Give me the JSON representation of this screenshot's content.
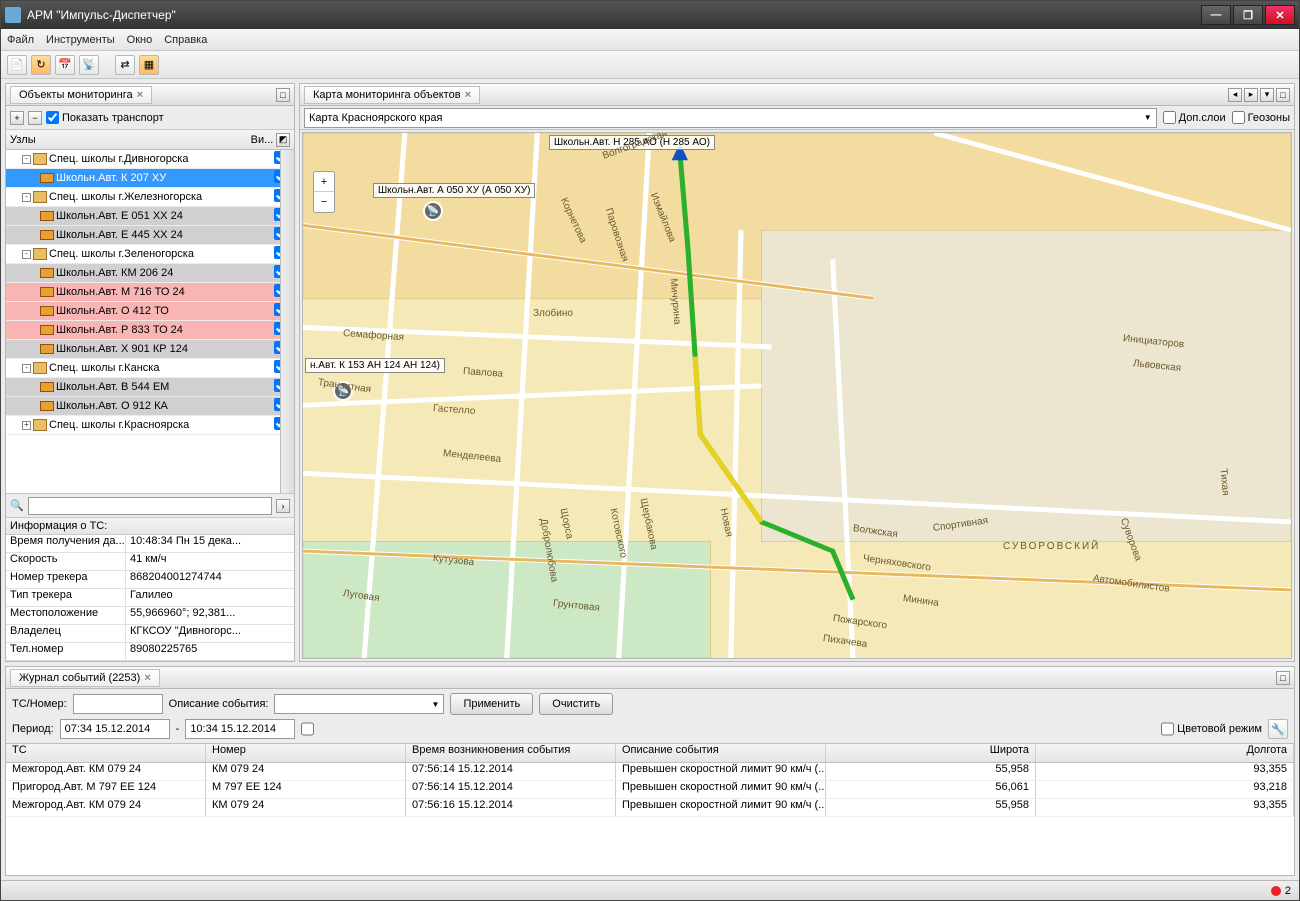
{
  "window": {
    "title": "АРМ \"Импульс-Диспетчер\""
  },
  "menu": {
    "file": "Файл",
    "tools": "Инструменты",
    "window": "Окно",
    "help": "Справка"
  },
  "left": {
    "tab": "Объекты мониторинга",
    "show_transport": "Показать транспорт",
    "col_nodes": "Узлы",
    "col_vis": "Ви...",
    "search_icon": "🔍",
    "info_header": "Информация о ТС:"
  },
  "tree": [
    {
      "lvl": 1,
      "exp": "-",
      "cls": "",
      "t": "Спец. школы г.Дивногорска",
      "chk": true
    },
    {
      "lvl": 2,
      "exp": "",
      "cls": "selected",
      "t": "Школьн.Авт. К 207 ХУ",
      "chk": true
    },
    {
      "lvl": 1,
      "exp": "-",
      "cls": "",
      "t": "Спец. школы г.Железногорска",
      "chk": true
    },
    {
      "lvl": 2,
      "exp": "",
      "cls": "gray",
      "t": "Школьн.Авт. Е 051 ХХ 24",
      "chk": true
    },
    {
      "lvl": 2,
      "exp": "",
      "cls": "gray",
      "t": "Школьн.Авт. Е 445 ХХ 24",
      "chk": true
    },
    {
      "lvl": 1,
      "exp": "-",
      "cls": "",
      "t": "Спец. школы г.Зеленогорска",
      "chk": true
    },
    {
      "lvl": 2,
      "exp": "",
      "cls": "gray",
      "t": "Школьн.Авт. КМ 206 24",
      "chk": true
    },
    {
      "lvl": 2,
      "exp": "",
      "cls": "pink",
      "t": "Школьн.Авт. М 716 ТО 24",
      "chk": true
    },
    {
      "lvl": 2,
      "exp": "",
      "cls": "pink",
      "t": "Школьн.Авт. О 412 ТО",
      "chk": true
    },
    {
      "lvl": 2,
      "exp": "",
      "cls": "pink",
      "t": "Школьн.Авт. Р 833 ТО 24",
      "chk": true
    },
    {
      "lvl": 2,
      "exp": "",
      "cls": "gray",
      "t": "Школьн.Авт. Х 901 КР 124",
      "chk": true
    },
    {
      "lvl": 1,
      "exp": "-",
      "cls": "",
      "t": "Спец. школы г.Канска",
      "chk": true
    },
    {
      "lvl": 2,
      "exp": "",
      "cls": "gray",
      "t": "Школьн.Авт. В 544 ЕМ",
      "chk": true
    },
    {
      "lvl": 2,
      "exp": "",
      "cls": "gray",
      "t": "Школьн.Авт. О 912 КА",
      "chk": true
    },
    {
      "lvl": 1,
      "exp": "+",
      "cls": "",
      "t": "Спец. школы г.Красноярска",
      "chk": true
    }
  ],
  "info": [
    {
      "l": "Время получения да...",
      "v": "10:48:34 Пн 15 дека..."
    },
    {
      "l": "Скорость",
      "v": "41 км/ч"
    },
    {
      "l": "Номер трекера",
      "v": "868204001274744"
    },
    {
      "l": "Тип трекера",
      "v": "Галилео"
    },
    {
      "l": "Местоположение",
      "v": "55,966960°; 92,381..."
    },
    {
      "l": "Владелец",
      "v": "КГКСОУ \"Дивногорс..."
    },
    {
      "l": "Тел.номер",
      "v": "89080225765"
    }
  ],
  "map": {
    "tab": "Карта мониторинга объектов",
    "combo": "Карта Красноярского края",
    "layers": "Доп.слои",
    "geozones": "Геозоны",
    "markers": {
      "m1": "Школьн.Авт. Н 285 АО\n(Н 285 АО)",
      "m2": "Школьн.Авт. А 050 ХУ\n(А 050 ХУ)",
      "m3": "н.Авт. К 153 АН 124\nАН 124)"
    },
    "streets": {
      "s1": "Волгоградская",
      "s2": "Мичурина",
      "s3": "Семафорная",
      "s4": "Злобино",
      "s5": "Павлова",
      "s6": "Транзитная",
      "s7": "Гастелло",
      "s8": "Менделеева",
      "s9": "Щорса",
      "s10": "Кутузова",
      "s11": "Грунтовая",
      "s12": "Луговая",
      "s13": "Волжская",
      "s14": "Спортивная",
      "s15": "СУВОРОВСКИЙ",
      "s16": "Автомобилистов",
      "s17": "Паровозная",
      "s18": "Корнетова",
      "s19": "Измайлова",
      "s20": "Пожарского",
      "s21": "Минина",
      "s22": "Суворова",
      "s23": "Котовского",
      "s24": "Добролюбова",
      "s25": "Щербакова",
      "s26": "Новая",
      "s27": "Черняховского",
      "s28": "Львовская",
      "s29": "Инициаторов",
      "s30": "Тихая",
      "s31": "Пихачева"
    }
  },
  "events": {
    "tab": "Журнал событий (2253)",
    "lbl_ts": "ТС/Номер:",
    "lbl_desc": "Описание события:",
    "btn_apply": "Применить",
    "btn_clear": "Очистить",
    "lbl_period": "Период:",
    "period_from": "07:34 15.12.2014",
    "period_to": "10:34 15.12.2014",
    "color_mode": "Цветовой режим",
    "cols": {
      "ts": "ТС",
      "num": "Номер",
      "time": "Время возникновения события",
      "desc": "Описание события",
      "lat": "Широта",
      "lon": "Долгота"
    },
    "rows": [
      {
        "ts": "Межгород.Авт. КМ 079 24",
        "num": "КМ 079 24",
        "time": "07:56:14 15.12.2014",
        "desc": "Превышен скоростной лимит 90 км/ч (...",
        "lat": "55,958",
        "lon": "93,355"
      },
      {
        "ts": "Пригород.Авт. М 797 ЕЕ 124",
        "num": "М 797 ЕЕ 124",
        "time": "07:56:14 15.12.2014",
        "desc": "Превышен скоростной лимит 90 км/ч (...",
        "lat": "56,061",
        "lon": "93,218"
      },
      {
        "ts": "Межгород.Авт. КМ 079 24",
        "num": "КМ 079 24",
        "time": "07:56:16 15.12.2014",
        "desc": "Превышен скоростной лимит 90 км/ч (...",
        "lat": "55,958",
        "lon": "93,355"
      }
    ]
  },
  "status": {
    "count": "2"
  }
}
